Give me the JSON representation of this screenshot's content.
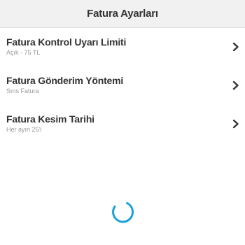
{
  "header": {
    "title": "Fatura Ayarları"
  },
  "items": [
    {
      "title": "Fatura Kontrol Uyarı Limiti",
      "subtitle": "Açık - 75 TL",
      "icon": "chevron-right-icon"
    },
    {
      "title": "Fatura Gönderim Yöntemi",
      "subtitle": "Sms Fatura",
      "icon": "chevron-right-icon"
    },
    {
      "title": "Fatura Kesim Tarihi",
      "subtitle": "Her ayın 25'i",
      "icon": "chevron-right-icon"
    }
  ],
  "loading": {
    "icon": "loading-spinner-icon",
    "color": "#1ba1d8"
  },
  "colors": {
    "header_bg": "#f1f1f1",
    "text": "#333333",
    "subtext": "#9a9a9a",
    "accent": "#1ba1d8"
  }
}
